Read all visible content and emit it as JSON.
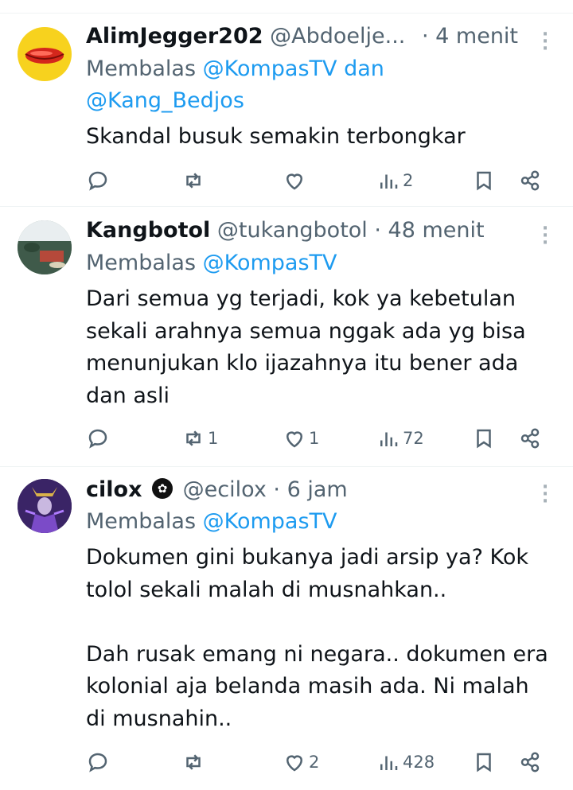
{
  "tweets": [
    {
      "name": "AlimJegger202",
      "handle": "@Abdoelje...",
      "time": "· 4 menit",
      "reply_prefix": "Membalas ",
      "reply_mention1": "@KompasTV",
      "reply_join": " dan",
      "reply_mention2": "@Kang_Bedjos",
      "text": "Skandal busuk semakin terbongkar",
      "retweets": "",
      "likes": "",
      "views": "2"
    },
    {
      "name": "Kangbotol",
      "handle": "@tukangbotol",
      "time": "· 48 menit",
      "reply_prefix": "Membalas ",
      "reply_mention1": "@KompasTV",
      "text": "Dari semua yg terjadi, kok ya kebetulan\nsekali arahnya semua nggak ada yg bisa\nmenunjukan klo ijazahnya itu bener ada\ndan asli",
      "retweets": "1",
      "likes": "1",
      "views": "72"
    },
    {
      "name": "cilox",
      "handle": "@ecilox",
      "time": "· 6 jam",
      "reply_prefix": "Membalas ",
      "reply_mention1": "@KompasTV",
      "text": "Dokumen gini bukanya jadi arsip ya? Kok\ntolol sekali malah di musnahkan..\n\nDah rusak emang ni negara.. dokumen era\nkolonial aja belanda masih ada. Ni malah\ndi musnahin..",
      "retweets": "",
      "likes": "2",
      "views": "428"
    }
  ],
  "colors": {
    "text": "#0f1419",
    "muted": "#536471",
    "accent": "#1d9bf0",
    "divider": "#eff3f4"
  }
}
